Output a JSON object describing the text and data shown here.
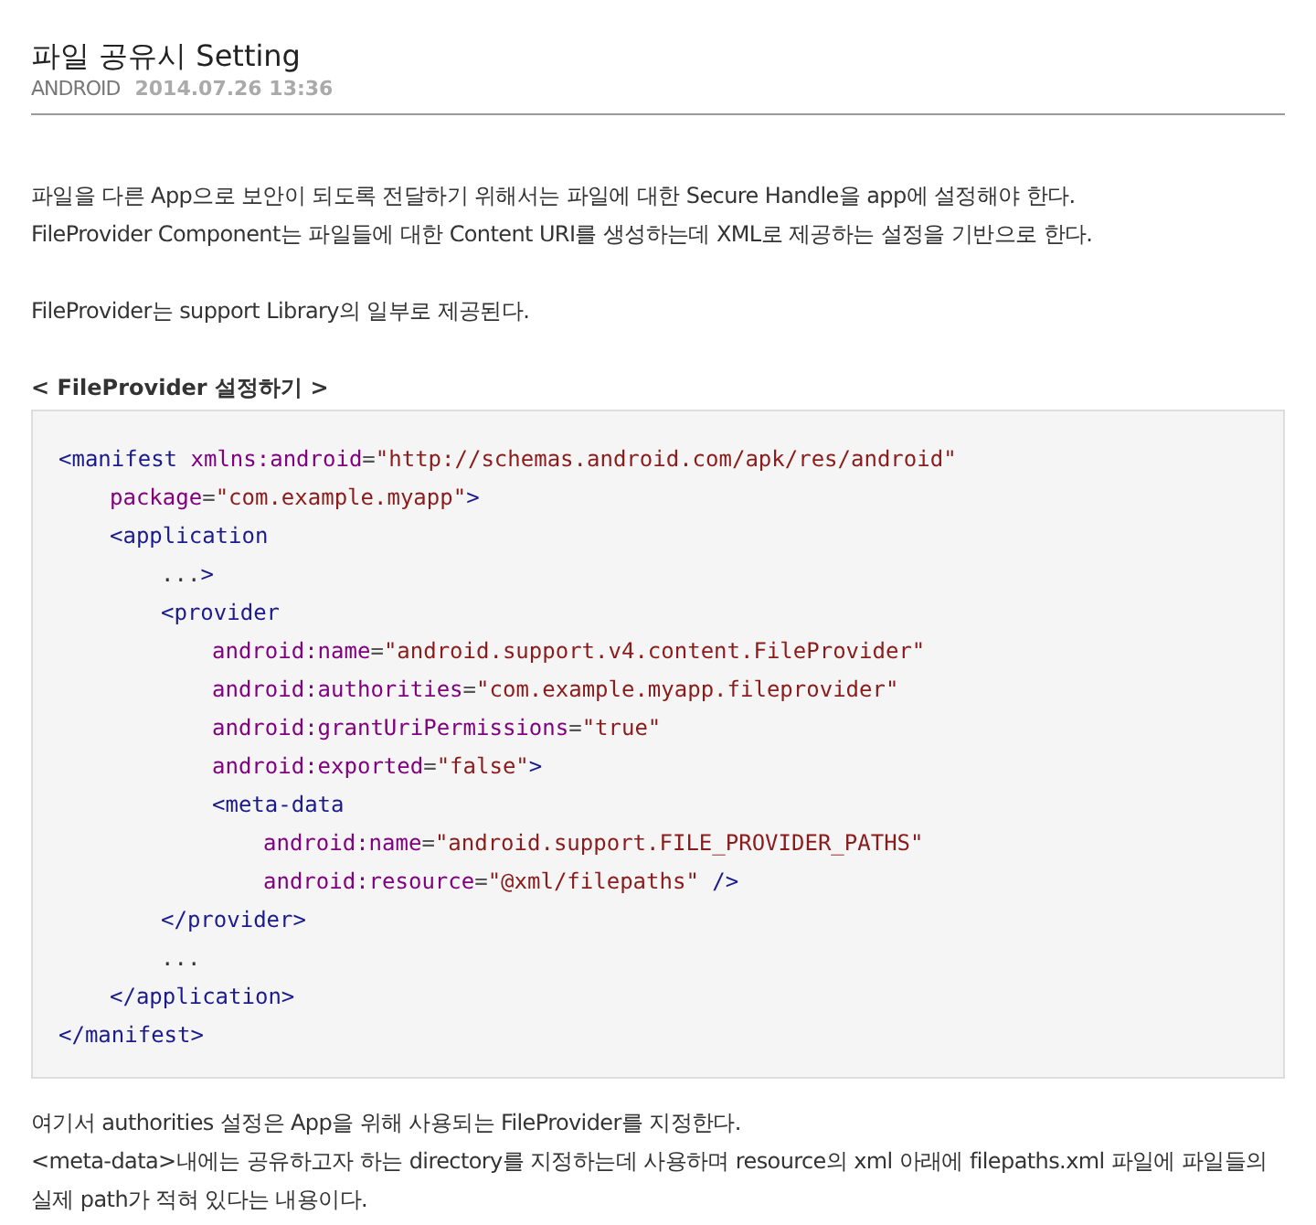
{
  "post": {
    "title": "파일 공유시 Setting",
    "category": "ANDROID",
    "date": "2014.07.26 13:36"
  },
  "intro": [
    [
      "파일을 다른 App으로 보안이 되도록 전달하기 위해서는 파일에 대한 Secure Handle을 app에 설정해야 한다.",
      "FileProvider Component는 파일들에 대한 Content URI를 생성하는데 XML로 제공하는 설정을 기반으로 한다."
    ],
    [
      "FileProvider는 support Library의 일부로 제공된다."
    ]
  ],
  "section_heading": "< FileProvider 설정하기 >",
  "code": [
    {
      "tokens": [
        {
          "kind": "tag",
          "text": "<manifest "
        },
        {
          "kind": "attr",
          "text": "xmlns:android"
        },
        {
          "kind": "punct",
          "text": "="
        },
        {
          "kind": "value",
          "text": "\"http://schemas.android.com/apk/res/android\""
        }
      ],
      "children": [
        {
          "tokens": [
            {
              "kind": "attr",
              "text": "package"
            },
            {
              "kind": "punct",
              "text": "="
            },
            {
              "kind": "value",
              "text": "\"com.example.myapp\""
            },
            {
              "kind": "tag",
              "text": ">"
            }
          ]
        },
        {
          "tokens": [
            {
              "kind": "tag",
              "text": "<application"
            }
          ],
          "children": [
            {
              "tokens": [
                {
                  "kind": "plain",
                  "text": "..."
                },
                {
                  "kind": "tag",
                  "text": ">"
                }
              ]
            },
            {
              "tokens": [
                {
                  "kind": "tag",
                  "text": "<provider"
                }
              ],
              "children": [
                {
                  "tokens": [
                    {
                      "kind": "attr",
                      "text": "android:name"
                    },
                    {
                      "kind": "punct",
                      "text": "="
                    },
                    {
                      "kind": "value",
                      "text": "\"android.support.v4.content.FileProvider\""
                    }
                  ]
                },
                {
                  "tokens": [
                    {
                      "kind": "attr",
                      "text": "android:authorities"
                    },
                    {
                      "kind": "punct",
                      "text": "="
                    },
                    {
                      "kind": "value",
                      "text": "\"com.example.myapp.fileprovider\""
                    }
                  ]
                },
                {
                  "tokens": [
                    {
                      "kind": "attr",
                      "text": "android:grantUriPermissions"
                    },
                    {
                      "kind": "punct",
                      "text": "="
                    },
                    {
                      "kind": "value",
                      "text": "\"true\""
                    }
                  ]
                },
                {
                  "tokens": [
                    {
                      "kind": "attr",
                      "text": "android:exported"
                    },
                    {
                      "kind": "punct",
                      "text": "="
                    },
                    {
                      "kind": "value",
                      "text": "\"false\""
                    },
                    {
                      "kind": "tag",
                      "text": ">"
                    }
                  ]
                },
                {
                  "tokens": [
                    {
                      "kind": "tag",
                      "text": "<meta-data"
                    }
                  ],
                  "children": [
                    {
                      "tokens": [
                        {
                          "kind": "attr",
                          "text": "android:name"
                        },
                        {
                          "kind": "punct",
                          "text": "="
                        },
                        {
                          "kind": "value",
                          "text": "\"android.support.FILE_PROVIDER_PATHS\""
                        }
                      ]
                    },
                    {
                      "tokens": [
                        {
                          "kind": "attr",
                          "text": "android:resource"
                        },
                        {
                          "kind": "punct",
                          "text": "="
                        },
                        {
                          "kind": "value",
                          "text": "\"@xml/filepaths\""
                        },
                        {
                          "kind": "tag",
                          "text": " />"
                        }
                      ]
                    }
                  ]
                }
              ]
            },
            {
              "tokens": [
                {
                  "kind": "tag",
                  "text": "</provider>"
                }
              ]
            },
            {
              "tokens": [
                {
                  "kind": "plain",
                  "text": "..."
                }
              ]
            }
          ]
        },
        {
          "tokens": [
            {
              "kind": "tag",
              "text": "</application>"
            }
          ]
        }
      ]
    },
    {
      "tokens": [
        {
          "kind": "tag",
          "text": "</manifest>"
        }
      ]
    }
  ],
  "outro": [
    "여기서 authorities 설정은 App을 위해 사용되는 FileProvider를 지정한다.",
    "<meta-data>내에는 공유하고자 하는 directory를 지정하는데 사용하며 resource의 xml 아래에 filepaths.xml 파일에 파일들의 실제 path가 적혀 있다는 내용이다."
  ]
}
